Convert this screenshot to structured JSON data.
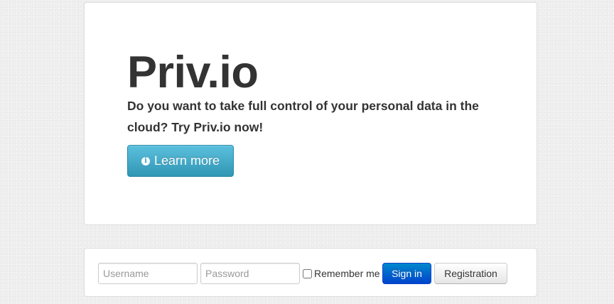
{
  "hero": {
    "title": "Priv.io",
    "tagline": "Do you want to take full control of your personal data in the cloud? Try Priv.io now!",
    "learn_more": {
      "label": "Learn more",
      "icon": "info-sign-icon",
      "icon_glyph": "i",
      "color": "#49afcd"
    }
  },
  "login": {
    "username_placeholder": "Username",
    "password_placeholder": "Password",
    "remember_label": "Remember me",
    "remember_checked": false,
    "signin_label": "Sign in",
    "signin_color": "#0074cc",
    "register_label": "Registration"
  }
}
